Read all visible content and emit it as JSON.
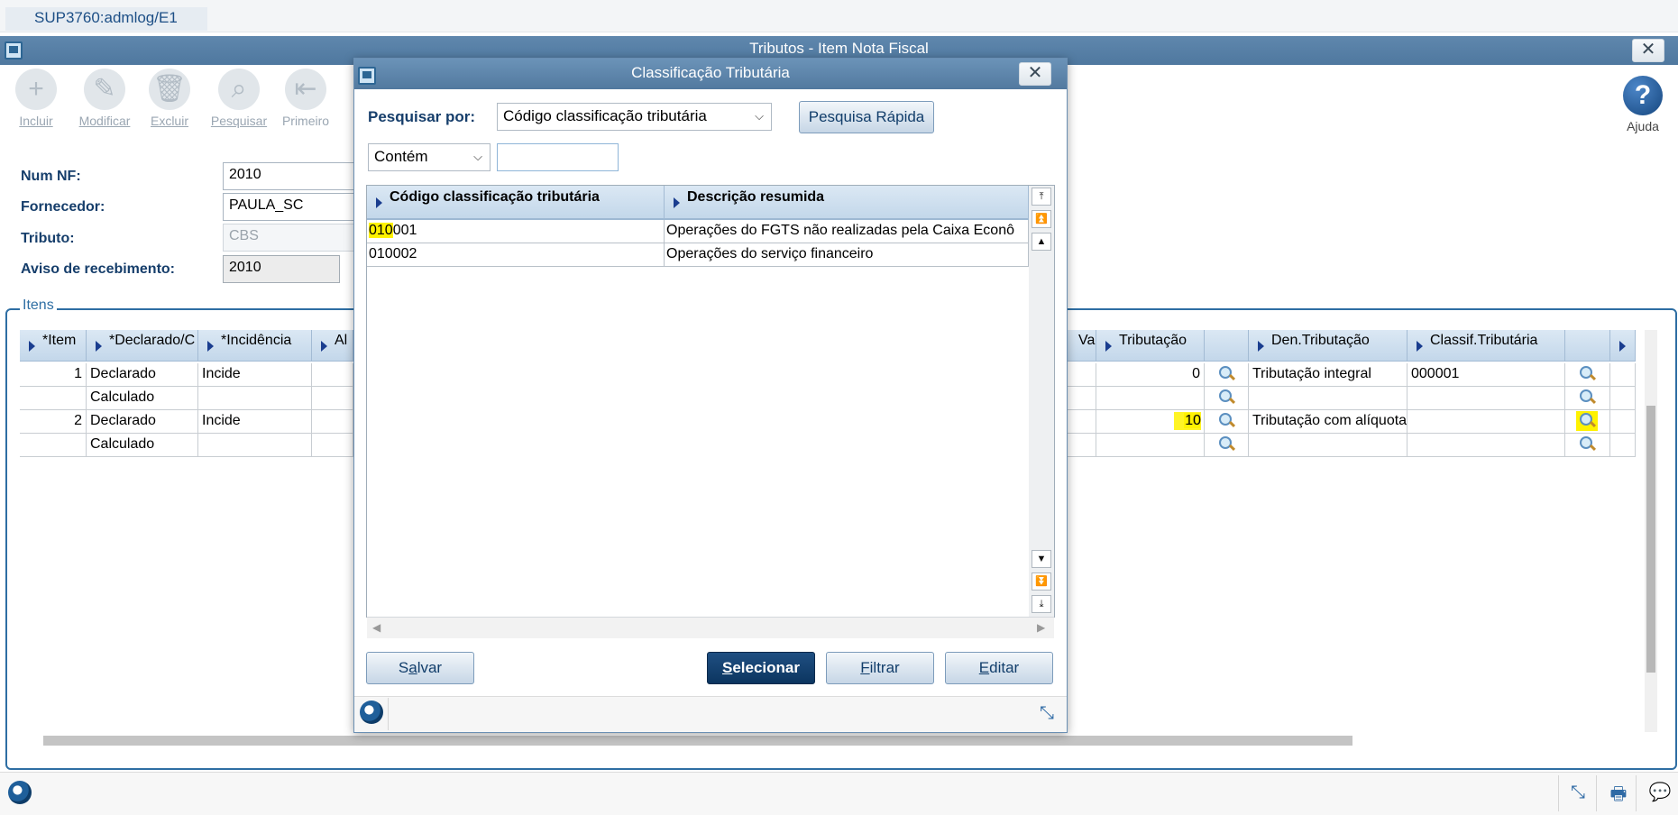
{
  "session": {
    "tab": "SUP3760:admlog/E1"
  },
  "main": {
    "title": "Tributos - Item Nota Fiscal",
    "close": "✕",
    "toolbar": [
      {
        "label": "Incluir",
        "icon": "add-icon"
      },
      {
        "label": "Modificar",
        "icon": "edit-icon"
      },
      {
        "label": "Excluir",
        "icon": "delete-icon"
      },
      {
        "label": "Pesquisar",
        "icon": "search-icon"
      },
      {
        "label": "Primeiro",
        "icon": "first-icon"
      }
    ],
    "help": {
      "label": "Ajuda",
      "glyph": "?"
    },
    "form": {
      "num_nf": {
        "label": "Num NF:",
        "value": "2010"
      },
      "fornecedor": {
        "label": "Fornecedor:",
        "value": "PAULA_SC"
      },
      "tributo": {
        "label": "Tributo:",
        "value": "CBS"
      },
      "aviso": {
        "label": "Aviso de recebimento:",
        "value": "2010"
      }
    },
    "items": {
      "legend": "Itens",
      "headers": [
        "*Item",
        "*Declarado/C",
        "*Incidência",
        "Al",
        "Va",
        "Tributação",
        "",
        "Den.Tributação",
        "Classif.Tributária",
        ""
      ],
      "rows": [
        {
          "item": "1",
          "tipo": "Declarado",
          "incidencia": "Incide",
          "tributacao": "0",
          "den": "Tributação integral",
          "classif": "000001"
        },
        {
          "item": "",
          "tipo": "Calculado",
          "incidencia": "",
          "tributacao": "",
          "den": "",
          "classif": ""
        },
        {
          "item": "2",
          "tipo": "Declarado",
          "incidencia": "Incide",
          "tributacao": "10",
          "den": "Tributação com alíquota",
          "classif": ""
        },
        {
          "item": "",
          "tipo": "Calculado",
          "incidencia": "",
          "tributacao": "",
          "den": "",
          "classif": ""
        }
      ]
    }
  },
  "dialog": {
    "title": "Classificação Tributária",
    "close": "✕",
    "search_by_label": "Pesquisar por:",
    "search_by_value": "Código classificação tributária",
    "quick_search": "Pesquisa Rápida",
    "match_value": "Contém",
    "search_text": "",
    "headers": [
      "Código classificação tributária",
      "Descrição resumida"
    ],
    "rows": [
      {
        "codigo_hl": "010",
        "codigo_rest": "001",
        "descricao": "Operações do FGTS não realizadas pela Caixa Econô"
      },
      {
        "codigo_hl": "",
        "codigo_rest": "010002",
        "descricao": "Operações do serviço financeiro"
      }
    ],
    "buttons": {
      "salvar": {
        "prefix": "S",
        "mnemonic": "a",
        "rest": "lvar"
      },
      "selecionar": {
        "prefix": "",
        "mnemonic": "S",
        "rest": "elecionar"
      },
      "filtrar": {
        "prefix": "",
        "mnemonic": "F",
        "rest": "iltrar"
      },
      "editar": {
        "prefix": "",
        "mnemonic": "E",
        "rest": "ditar"
      }
    }
  }
}
